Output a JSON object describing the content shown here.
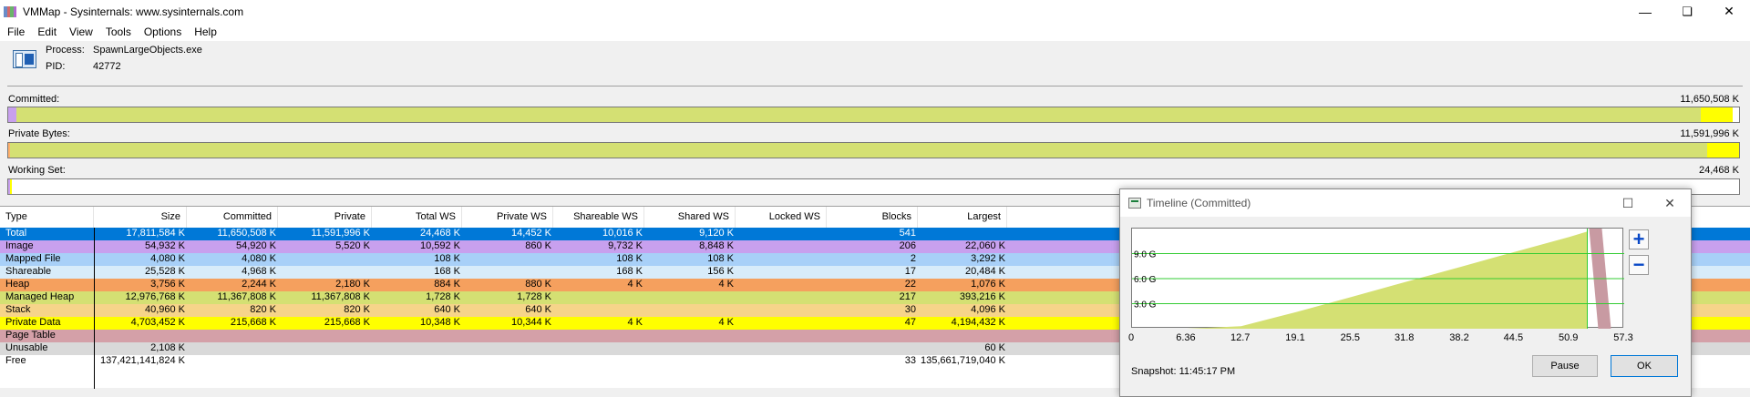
{
  "window": {
    "title": "VMMap - Sysinternals: www.sysinternals.com",
    "min_glyph": "—",
    "max_glyph": "❏",
    "close_glyph": "✕"
  },
  "menu": [
    "File",
    "Edit",
    "View",
    "Tools",
    "Options",
    "Help"
  ],
  "process": {
    "process_label": "Process:",
    "process_value": "SpawnLargeObjects.exe",
    "pid_label": "PID:",
    "pid_value": "42772"
  },
  "bars": {
    "committed": {
      "label": "Committed:",
      "value": "11,650,508 K",
      "segments": [
        {
          "fraction": 0.0047,
          "color": "#c8a0ee"
        },
        {
          "fraction": 0.973,
          "color": "#d4e073"
        },
        {
          "fraction": 0.0185,
          "color": "#ffff00"
        }
      ]
    },
    "private_bytes": {
      "label": "Private Bytes:",
      "value": "11,591,996 K",
      "segments": [
        {
          "fraction": 0.0005,
          "color": "#ffb06a"
        },
        {
          "fraction": 0.981,
          "color": "#d4e073"
        },
        {
          "fraction": 0.0185,
          "color": "#ffff00"
        }
      ]
    },
    "working_set": {
      "label": "Working Set:",
      "value": "24,468 K",
      "segments": [
        {
          "fraction": 0.001,
          "color": "#c8a0ee"
        },
        {
          "fraction": 0.001,
          "color": "#ffff00"
        }
      ]
    }
  },
  "table": {
    "columns": [
      "Type",
      "Size",
      "Committed",
      "Private",
      "Total WS",
      "Private WS",
      "Shareable WS",
      "Shared WS",
      "Locked WS",
      "Blocks",
      "Largest"
    ],
    "rows": [
      {
        "color": "#0078d7",
        "text_color": "#ffffff",
        "cells": [
          "Total",
          "17,811,584 K",
          "11,650,508 K",
          "11,591,996 K",
          "24,468 K",
          "14,452 K",
          "10,016 K",
          "9,120 K",
          "",
          "541",
          ""
        ]
      },
      {
        "color": "#c8a0ee",
        "text_color": "#000000",
        "cells": [
          "Image",
          "54,932 K",
          "54,920 K",
          "5,520 K",
          "10,592 K",
          "860 K",
          "9,732 K",
          "8,848 K",
          "",
          "206",
          "22,060 K"
        ]
      },
      {
        "color": "#a8d0f8",
        "text_color": "#000000",
        "cells": [
          "Mapped File",
          "4,080 K",
          "4,080 K",
          "",
          "108 K",
          "",
          "108 K",
          "108 K",
          "",
          "2",
          "3,292 K"
        ]
      },
      {
        "color": "#d8ecfa",
        "text_color": "#000000",
        "cells": [
          "Shareable",
          "25,528 K",
          "4,968 K",
          "",
          "168 K",
          "",
          "168 K",
          "156 K",
          "",
          "17",
          "20,484 K"
        ]
      },
      {
        "color": "#f5a05e",
        "text_color": "#000000",
        "cells": [
          "Heap",
          "3,756 K",
          "2,244 K",
          "2,180 K",
          "884 K",
          "880 K",
          "4 K",
          "4 K",
          "",
          "22",
          "1,076 K"
        ]
      },
      {
        "color": "#d4e073",
        "text_color": "#000000",
        "cells": [
          "Managed Heap",
          "12,976,768 K",
          "11,367,808 K",
          "11,367,808 K",
          "1,728 K",
          "1,728 K",
          "",
          "",
          "",
          "217",
          "393,216 K"
        ]
      },
      {
        "color": "#f6d48a",
        "text_color": "#000000",
        "cells": [
          "Stack",
          "40,960 K",
          "820 K",
          "820 K",
          "640 K",
          "640 K",
          "",
          "",
          "",
          "30",
          "4,096 K"
        ]
      },
      {
        "color": "#ffff00",
        "text_color": "#000000",
        "cells": [
          "Private Data",
          "4,703,452 K",
          "215,668 K",
          "215,668 K",
          "10,348 K",
          "10,344 K",
          "4 K",
          "4 K",
          "",
          "47",
          "4,194,432 K"
        ]
      },
      {
        "color": "#d4a0a8",
        "text_color": "#000000",
        "cells": [
          "Page Table",
          "",
          "",
          "",
          "",
          "",
          "",
          "",
          "",
          "",
          ""
        ]
      },
      {
        "color": "#d9d9d9",
        "text_color": "#000000",
        "cells": [
          "Unusable",
          "2,108 K",
          "",
          "",
          "",
          "",
          "",
          "",
          "",
          "",
          "60 K"
        ]
      },
      {
        "color": "#ffffff",
        "text_color": "#000000",
        "cells": [
          "Free",
          "137,421,141,824 K",
          "",
          "",
          "",
          "",
          "",
          "",
          "",
          "33",
          "135,661,719,040 K"
        ]
      }
    ]
  },
  "timeline": {
    "title": "Timeline (Committed)",
    "y_ticks": [
      "9.0 G",
      "6.0 G",
      "3.0 G"
    ],
    "x_ticks": [
      "0",
      "6.36",
      "12.7",
      "19.1",
      "25.5",
      "31.8",
      "38.2",
      "44.5",
      "50.9",
      "57.3"
    ],
    "zoom_in_glyph": "+",
    "zoom_out_glyph": "−",
    "snapshot_label": "Snapshot:",
    "snapshot_time": "11:45:17 PM",
    "pause_label": "Pause",
    "ok_label": "OK",
    "chart_data": {
      "type": "area",
      "x": [
        0,
        6.36,
        12.7,
        19.1,
        25.5,
        31.8,
        38.2,
        44.5,
        50.9,
        53.0
      ],
      "y_gb": [
        0,
        0,
        0.3,
        2.0,
        3.8,
        5.6,
        7.4,
        9.2,
        11.0,
        11.65
      ],
      "xlim": [
        0,
        57.3
      ],
      "ylim_gb": [
        0,
        12
      ],
      "fill_color": "#d4e073",
      "grid_color": "#33cc33",
      "marker_x": 53.0,
      "marker_color": "#c89aa2"
    }
  }
}
